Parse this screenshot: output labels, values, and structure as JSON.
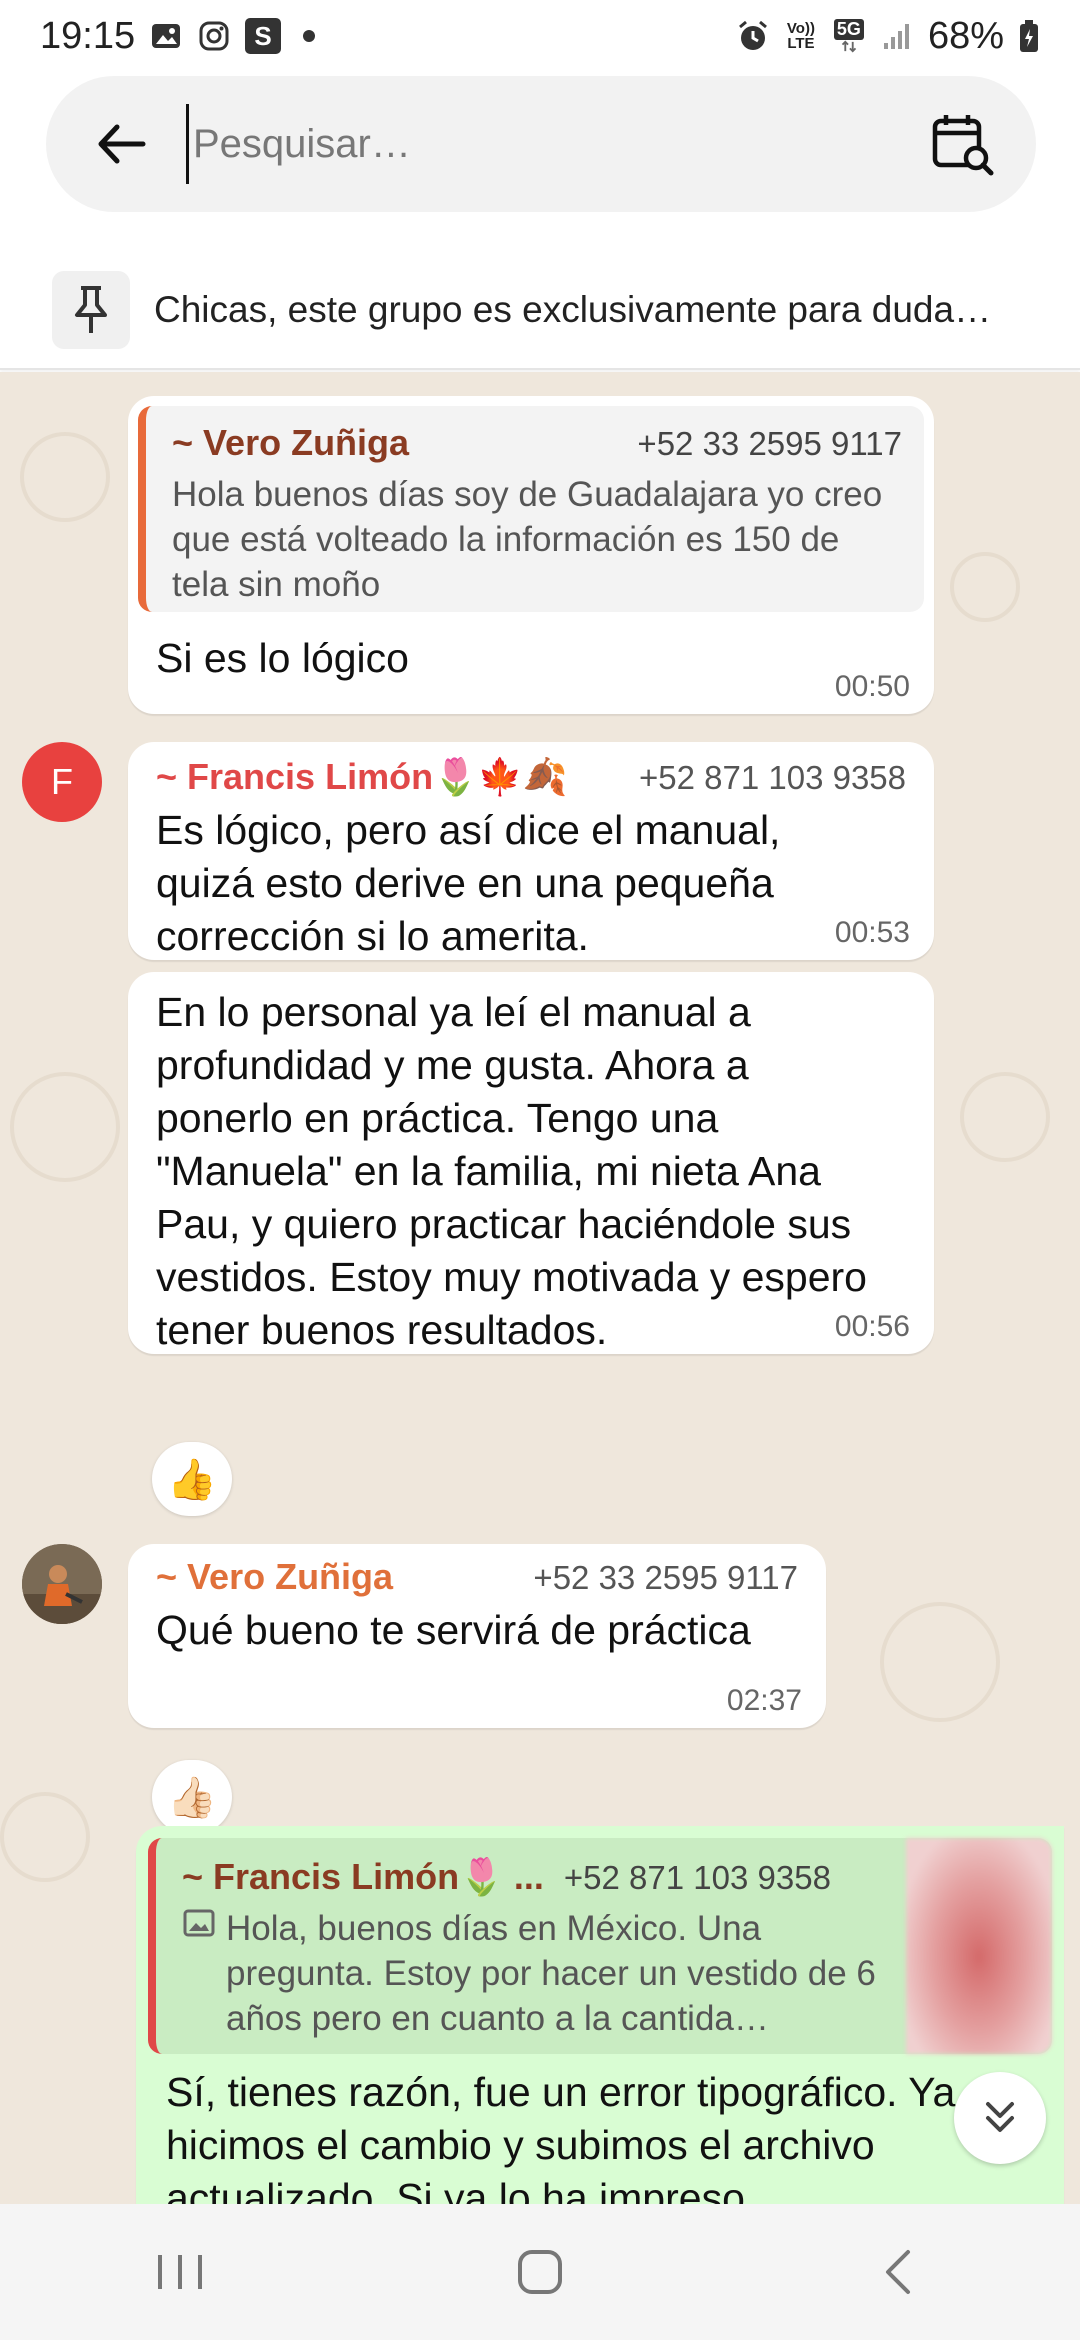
{
  "status_bar": {
    "time": "19:15",
    "battery": "68%",
    "network": "5G",
    "volte_top": "Vo))",
    "volte_bottom": "LTE",
    "notification_icons": [
      "gallery-icon",
      "instagram-icon",
      "s-app-icon",
      "dot-icon"
    ],
    "system_icons": [
      "alarm-icon",
      "volte-icon",
      "5g-icon",
      "signal-icon",
      "battery-icon"
    ]
  },
  "search": {
    "placeholder": "Pesquisar…",
    "value": ""
  },
  "pinned": {
    "text": "Chicas, este grupo es exclusivamente para duda…"
  },
  "messages": [
    {
      "quote_sender": "~ Vero Zuñiga",
      "quote_phone": "+52 33 2595 9117",
      "quote_text": "Hola buenos días soy de Guadalajara yo creo que está volteado la información es 150 de tela sin moño",
      "text": "Si es lo lógico",
      "time": "00:50"
    },
    {
      "avatar_letter": "F",
      "sender": "~ Francis Limón🌷🍁🍂",
      "phone": "+52 871 103 9358",
      "text": "Es lógico, pero así dice el manual, quizá esto derive en una pequeña corrección si lo amerita.",
      "time": "00:53"
    },
    {
      "text": "En lo personal ya leí el manual a profundidad y me  gusta. Ahora a ponerlo en práctica. Tengo una \"Manuela\" en la familia, mi nieta Ana Pau, y quiero practicar haciéndole sus vestidos. Estoy muy motivada y espero tener buenos resultados.",
      "time": "00:56",
      "reaction": "👍"
    },
    {
      "sender": "~ Vero Zuñiga",
      "phone": "+52 33 2595 9117",
      "text": "Qué bueno te servirá de práctica",
      "time": "02:37",
      "reaction": "👍🏻"
    },
    {
      "quote_sender": "~ Francis Limón🌷 ...",
      "quote_phone": "+52 871 103 9358",
      "quote_text": "Hola, buenos días en México. Una pregunta. Estoy por hacer un vestido de 6 años pero en cuanto a la cantida…",
      "text": "Sí, tienes razón, fue un error tipográfico. Ya hicimos el cambio y subimos el archivo actualizado.  Si ya lo ha impreso"
    }
  ],
  "colors": {
    "vero_name": "#8a3b22",
    "vero_name_light": "#e0703a",
    "francis_name": "#e04848",
    "avatar_f": "#e8413f",
    "quote_bar": "#e86a3a",
    "outgoing": "#d9fdd3",
    "chat_bg": "#efe7dc"
  }
}
